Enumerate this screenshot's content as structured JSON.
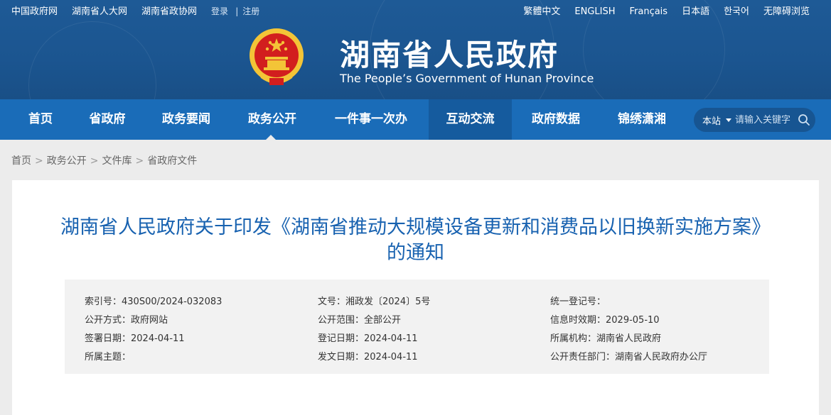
{
  "topbar": {
    "left_links": [
      "中国政府网",
      "湖南省人大网",
      "湖南省政协网"
    ],
    "login": "登录",
    "divider": "|",
    "register": "注册",
    "languages": [
      "繁體中文",
      "ENGLISH",
      "Français",
      "日本語",
      "한국어",
      "无障碍浏览"
    ]
  },
  "header": {
    "title": "湖南省人民政府",
    "subtitle": "The People’s Government of Hunan Province"
  },
  "nav": {
    "items": [
      "首页",
      "省政府",
      "政务要闻",
      "政务公开",
      "一件事一次办",
      "互动交流",
      "政府数据",
      "锦绣潇湘"
    ],
    "active": "政务公开"
  },
  "search": {
    "scope": "本站",
    "placeholder": "请输入关键字"
  },
  "breadcrumb": {
    "items": [
      "首页",
      "政务公开",
      "文件库",
      "省政府文件"
    ],
    "separator": ">"
  },
  "document": {
    "title": "湖南省人民政府关于印发《湖南省推动大规模设备更新和消费品以旧换新实施方案》的通知",
    "meta": [
      [
        "索引号：430S00/2024-032083",
        "文号：湘政发〔2024〕5号",
        "统一登记号："
      ],
      [
        "公开方式：政府网站",
        "公开范围：全部公开",
        "信息时效期：2029-05-10"
      ],
      [
        "签署日期：2024-04-11",
        "登记日期：2024-04-11",
        "所属机构：湖南省人民政府"
      ],
      [
        "所属主题：",
        "发文日期：2024-04-11",
        "公开责任部门：湖南省人民政府办公厅"
      ]
    ]
  },
  "colors": {
    "header_blue": "#1e5a96",
    "nav_blue": "#1a6cb8",
    "title_blue": "#1862b0",
    "emblem_red": "#d21e1e",
    "emblem_gold": "#f3c437"
  }
}
